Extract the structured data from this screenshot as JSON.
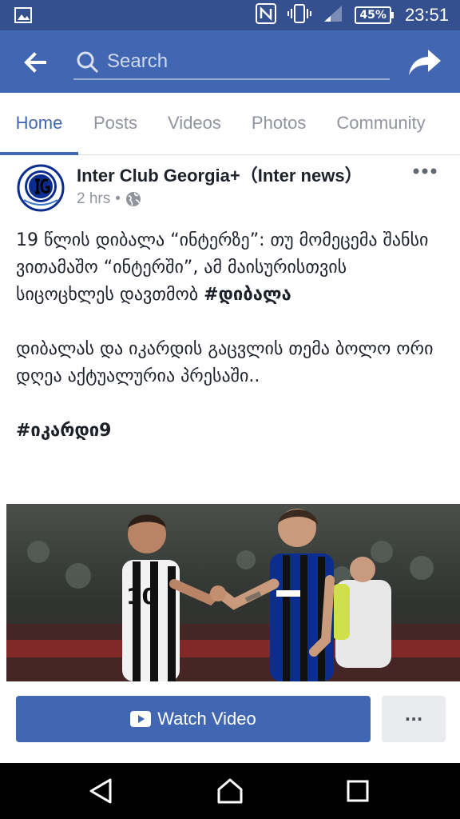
{
  "status_bar": {
    "time": "23:51",
    "battery": "45%"
  },
  "search": {
    "placeholder": "Search",
    "value": ""
  },
  "tabs": [
    {
      "label": "Home",
      "active": true
    },
    {
      "label": "Posts",
      "active": false
    },
    {
      "label": "Videos",
      "active": false
    },
    {
      "label": "Photos",
      "active": false
    },
    {
      "label": "Community",
      "active": false
    }
  ],
  "post": {
    "page_name": "Inter Club Georgia+（Inter news）",
    "time": "2 hrs",
    "paragraphs": [
      "19  წლის დიბალა “ინტერზე”: თუ მომეცემა შანსი ვითამაშო “ინტერში”, ამ მაისურისთვის სიცოცხლეს დავთმობ",
      "დიბალას და იკარდის გაცვლის თემა ბოლო ორი დღეა აქტუალურია პრესაში.."
    ],
    "hashtags": [
      "#დიბალა",
      "#იკარდი9"
    ],
    "watch_label": "Watch Video",
    "more_label": "···"
  },
  "colors": {
    "brand": "#4267b2",
    "status_bar": "#35508f",
    "inter_blue": "#0b2d8f",
    "juve_white": "#f2f2f2"
  }
}
